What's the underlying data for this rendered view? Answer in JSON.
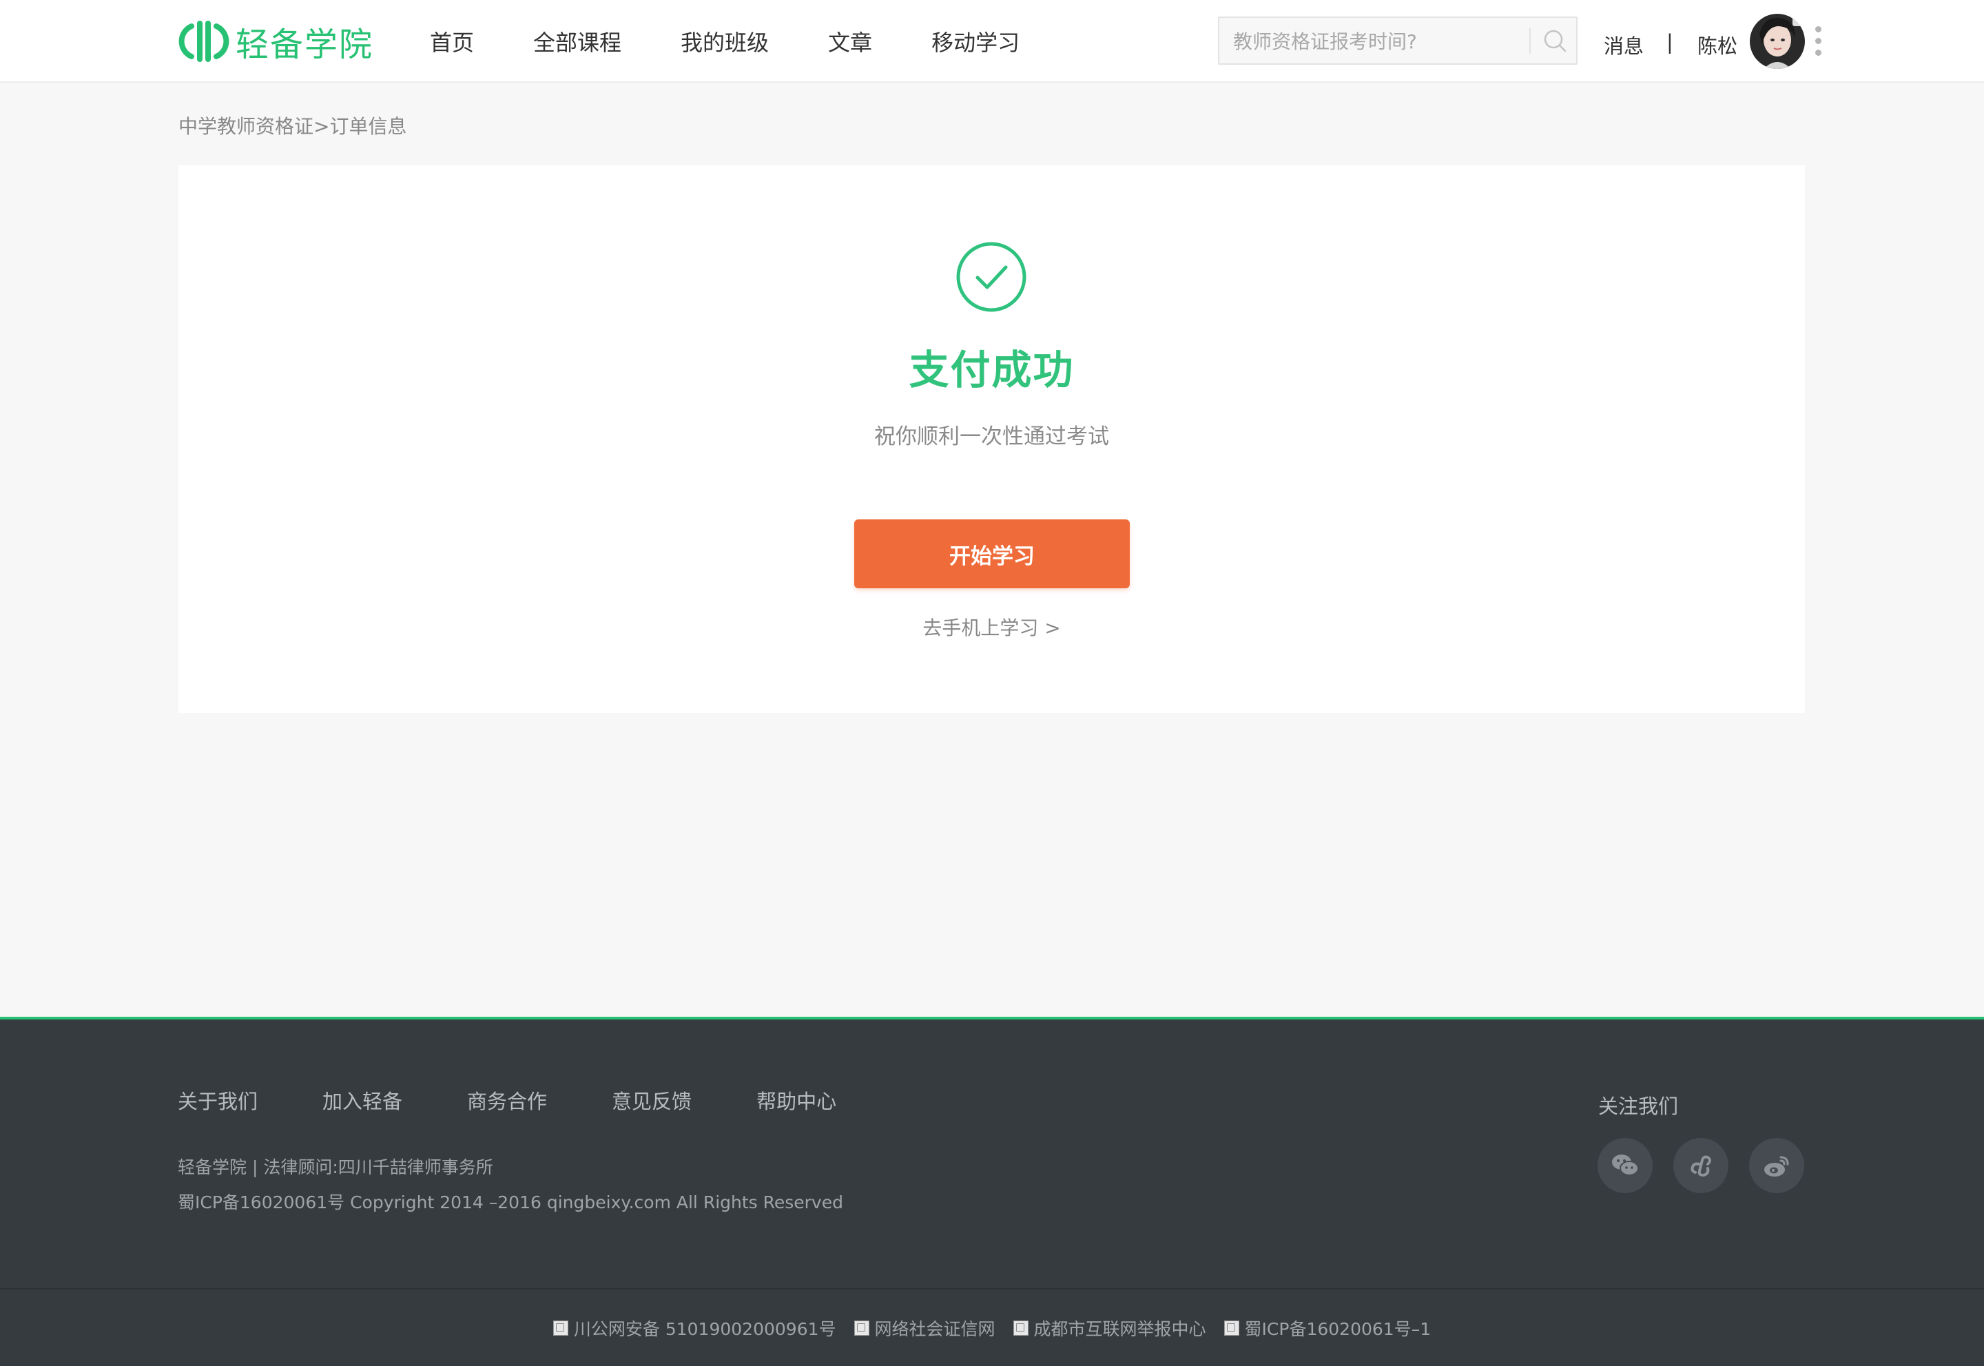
{
  "header": {
    "logo_text": "轻备学院",
    "nav": [
      "首页",
      "全部课程",
      "我的班级",
      "文章",
      "移动学习"
    ],
    "search_placeholder": "教师资格证报考时间?",
    "messages": "消息",
    "separator": "|",
    "username": "陈松"
  },
  "breadcrumb": {
    "parent": "中学教师资格证",
    "arrow": ">",
    "current": "订单信息"
  },
  "main": {
    "title": "支付成功",
    "subtitle": "祝你顺利一次性通过考试",
    "start_button": "开始学习",
    "mobile_link": "去手机上学习 >"
  },
  "footer": {
    "links": [
      "关于我们",
      "加入轻备",
      "商务合作",
      "意见反馈",
      "帮助中心"
    ],
    "info_line1": "轻备学院 | 法律顾问:四川千喆律师事务所",
    "info_line2": "蜀ICP备16020061号 Copyright 2014 –2016 qingbeixy.com All Rights Reserved",
    "follow_title": "关注我们",
    "bottom_links": [
      "川公网安备 51019002000961号",
      "网络社会证信网",
      "成都市互联网举报中心",
      "蜀ICP备16020061号–1"
    ]
  },
  "colors": {
    "brand_green": "#27c173",
    "accent_orange": "#ef6b3a",
    "footer_bg": "#353b3f"
  },
  "icons": [
    "logo-icon",
    "search-icon",
    "avatar",
    "more-icon",
    "check-circle-icon",
    "wechat-icon",
    "link-icon",
    "weibo-icon"
  ]
}
